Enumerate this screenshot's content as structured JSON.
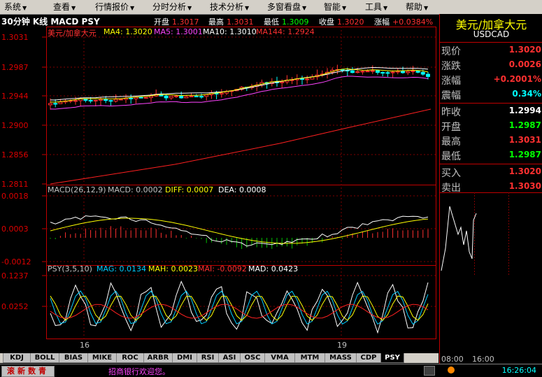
{
  "menu": {
    "items": [
      "系统",
      "查看",
      "行情报价",
      "分时分析",
      "技术分析",
      "多窗看盘",
      "智能",
      "工具",
      "帮助"
    ]
  },
  "header": {
    "page_title": "30分钟 K线 MACD PSY",
    "open_label": "开盘",
    "open_value": "1.3017",
    "high_label": "最高",
    "high_value": "1.3031",
    "low_label": "最低",
    "low_value": "1.3009",
    "close_label": "收盘",
    "close_value": "1.3020",
    "change_label": "涨幅",
    "change_value": "+0.0384%"
  },
  "kline": {
    "legend": {
      "name": "美元/加拿大元",
      "ma4": "MA4: 1.3020",
      "ma5": "MA5: 1.3001",
      "ma10": "MA10: 1.3010",
      "ma144": "MA144: 1.2924"
    },
    "yticks": [
      "1.3031",
      "1.2987",
      "1.2944",
      "1.2900",
      "1.2856",
      "1.2811"
    ]
  },
  "macd": {
    "legend": {
      "name": "MACD(26,12,9)",
      "macd": "MACD: 0.0002",
      "diff": "DIFF: 0.0007",
      "dea": "DEA: 0.0008"
    },
    "yticks": [
      "0.0018",
      "0.0003",
      "-0.0012"
    ]
  },
  "psy": {
    "legend": {
      "name": "PSY(3,5,10)",
      "mag": "MAG: 0.0134",
      "mah": "MAH: 0.0023",
      "mai": "MAI: -0.0092",
      "mad": "MAD: 0.0423"
    },
    "yticks": [
      "0.1237",
      "0.0252"
    ]
  },
  "xaxis": {
    "labels": [
      "16",
      "19"
    ]
  },
  "tabs": [
    "KDJ",
    "BOLL",
    "BIAS",
    "MIKE",
    "ROC",
    "ARBR",
    "DMI",
    "RSI",
    "ASI",
    "OSC",
    "VMA",
    "MTM",
    "MASS",
    "CDP",
    "PSY"
  ],
  "active_tab": "PSY",
  "quote": {
    "name": "美元/加拿大元",
    "code": "USDCAD",
    "rows": [
      {
        "label": "现价",
        "value": "1.3020",
        "color": "#ff3030"
      },
      {
        "label": "涨跌",
        "value": "0.0026",
        "color": "#ff3030"
      },
      {
        "label": "涨幅",
        "value": "+0.2001%",
        "color": "#ff3030"
      },
      {
        "label": "震幅",
        "value": "0.34%",
        "color": "#00ffff"
      },
      {
        "label": "昨收",
        "value": "1.2994",
        "color": "#ffffff"
      },
      {
        "label": "开盘",
        "value": "1.2987",
        "color": "#00ff00"
      },
      {
        "label": "最高",
        "value": "1.3031",
        "color": "#ff3030"
      },
      {
        "label": "最低",
        "value": "1.2987",
        "color": "#00ff00"
      },
      {
        "label": "买入",
        "value": "1.3020",
        "color": "#ff3030"
      },
      {
        "label": "卖出",
        "value": "1.3030",
        "color": "#ff3030"
      }
    ],
    "time_labels": [
      "08:00",
      "16:00"
    ]
  },
  "status": {
    "news_button": "滚新数青",
    "welcome": "招商银行欢迎您。",
    "clock": "16:26:04"
  },
  "colors": {
    "up": "#ff3030",
    "down": "#00ffff",
    "grid": "#c00000",
    "ma4": "#ffff00",
    "ma5": "#ff44ff",
    "ma10": "#ffffff"
  }
}
